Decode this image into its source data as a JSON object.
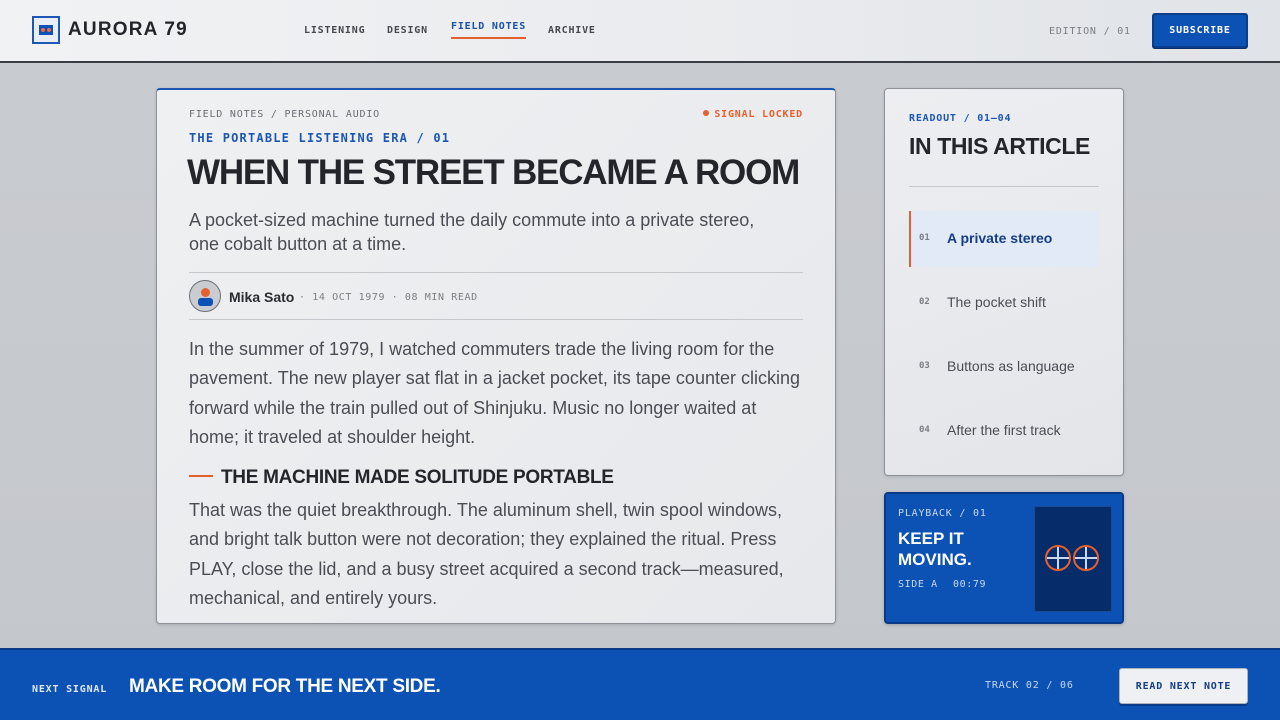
{
  "header": {
    "brand": "AURORA 79",
    "nav": [
      {
        "label": "LISTENING",
        "active": false
      },
      {
        "label": "DESIGN",
        "active": false
      },
      {
        "label": "FIELD NOTES",
        "active": true
      },
      {
        "label": "ARCHIVE",
        "active": false
      }
    ],
    "edition": "EDITION / 01",
    "subscribe_label": "SUBSCRIBE"
  },
  "article": {
    "kicker": "FIELD NOTES / PERSONAL AUDIO",
    "signal": "SIGNAL LOCKED",
    "series": "THE PORTABLE LISTENING ERA / 01",
    "title": "WHEN THE STREET BECAME A ROOM",
    "dek": "A pocket-sized machine turned the daily commute into a private stereo, one cobalt button at a time.",
    "author": "Mika Sato",
    "dateline": "· 14 OCT 1979 · 08 MIN READ",
    "paragraph_1": "In the summer of 1979, I watched commuters trade the living room for the pavement. The new player sat flat in a jacket pocket, its tape counter clicking forward while the train pulled out of Shinjuku. Music no longer waited at home; it traveled at shoulder height.",
    "subhead": "THE MACHINE MADE SOLITUDE PORTABLE",
    "paragraph_2": "That was the quiet breakthrough. The aluminum shell, twin spool windows, and bright talk button were not decoration; they explained the ritual. Press PLAY, close the lid, and a busy street acquired a second track—measured, mechanical, and entirely yours."
  },
  "toc": {
    "kicker": "READOUT / 01—04",
    "title": "IN THIS ARTICLE",
    "items": [
      {
        "num": "01",
        "label": "A private stereo",
        "active": true
      },
      {
        "num": "02",
        "label": "The pocket shift",
        "active": false
      },
      {
        "num": "03",
        "label": "Buttons as language",
        "active": false
      },
      {
        "num": "04",
        "label": "After the first track",
        "active": false
      }
    ]
  },
  "playback": {
    "kicker": "PLAYBACK / 01",
    "title": "KEEP IT MOVING.",
    "side": "SIDE A",
    "time": "00:79"
  },
  "footer": {
    "kicker": "NEXT SIGNAL",
    "title": "MAKE ROOM FOR THE NEXT SIDE.",
    "track": "TRACK 02 / 06",
    "button_label": "READ NEXT NOTE"
  },
  "colors": {
    "accent_blue": "#0c52b5",
    "accent_orange": "#e5602f",
    "ink": "#23252a"
  }
}
